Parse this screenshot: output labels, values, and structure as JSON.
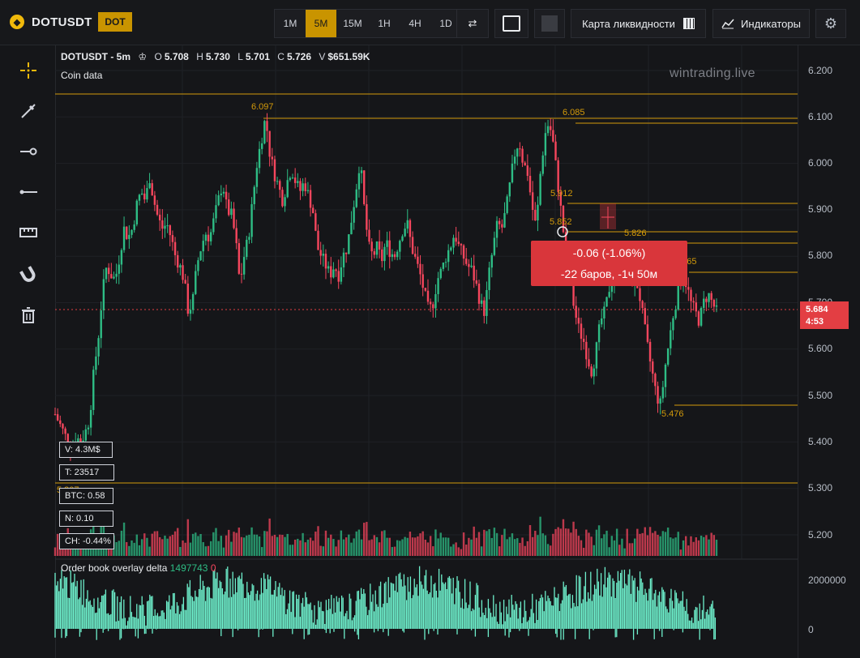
{
  "header": {
    "symbol": "DOTUSDT",
    "badge": "DOT",
    "timeframes": [
      "1M",
      "5M",
      "15M",
      "1H",
      "4H",
      "1D"
    ],
    "active_timeframe": "5M",
    "liquidity_map_label": "Карта ликвидности",
    "indicators_label": "Индикаторы"
  },
  "info": {
    "pair_tf": "DOTUSDT - 5m",
    "o_label": "O",
    "o": "5.708",
    "h_label": "H",
    "h": "5.730",
    "l_label": "L",
    "l": "5.701",
    "c_label": "C",
    "c": "5.726",
    "v_label": "V",
    "v": "$651.59K",
    "coin_data": "Coin data"
  },
  "watermark": "wintrading.live",
  "price_labels": {
    "p6097": "6.097",
    "p6085": "6.085",
    "p5912": "5.912",
    "p5852": "5.852",
    "p5826": "5.826",
    "p5765": "5.765",
    "p5476": "5.476",
    "p5307": "5.307"
  },
  "stats": {
    "v": "V: 4.3M$",
    "t": "T: 23517",
    "btc": "BTC: 0.58",
    "n": "N: 0.10",
    "ch": "CH: -0.44%"
  },
  "measure": {
    "line1": "-0.06 (-1.06%)",
    "line2": "-22 баров, -1ч 50м"
  },
  "price_axis": [
    "6.200",
    "6.100",
    "6.000",
    "5.900",
    "5.800",
    "5.700",
    "5.600",
    "5.500",
    "5.400",
    "5.300",
    "5.200"
  ],
  "current_price": {
    "price": "5.684",
    "countdown": "4:53"
  },
  "orderbook": {
    "title": "Order book overlay delta",
    "value_pos": "1497743",
    "value_neg": "0",
    "axis": [
      "2000000",
      "0"
    ]
  },
  "colors": {
    "up": "#2ebd85",
    "down": "#f6465d",
    "accent": "#c99400",
    "level": "#d39a0a",
    "delta": "#6ef0cc"
  },
  "chart_data": {
    "type": "candlestick",
    "symbol": "DOTUSDT",
    "interval": "5m",
    "ylim": [
      5.15,
      6.25
    ],
    "price_trace": [
      5.46,
      5.44,
      5.42,
      5.4,
      5.39,
      5.41,
      5.4,
      5.42,
      5.45,
      5.55,
      5.62,
      5.72,
      5.78,
      5.76,
      5.75,
      5.8,
      5.86,
      5.84,
      5.86,
      5.91,
      5.94,
      5.92,
      5.97,
      5.92,
      5.88,
      5.86,
      5.87,
      5.84,
      5.8,
      5.78,
      5.75,
      5.68,
      5.7,
      5.78,
      5.82,
      5.85,
      5.84,
      5.88,
      5.92,
      5.96,
      5.9,
      5.89,
      5.84,
      5.74,
      5.8,
      5.84,
      5.92,
      6.0,
      6.05,
      6.1,
      6.02,
      5.98,
      5.95,
      5.92,
      5.96,
      5.99,
      5.96,
      5.94,
      5.96,
      5.93,
      5.9,
      5.82,
      5.8,
      5.78,
      5.76,
      5.78,
      5.76,
      5.8,
      5.82,
      5.88,
      5.94,
      6.01,
      5.9,
      5.82,
      5.8,
      5.82,
      5.79,
      5.83,
      5.81,
      5.8,
      5.83,
      5.86,
      5.87,
      5.82,
      5.79,
      5.76,
      5.72,
      5.68,
      5.7,
      5.75,
      5.77,
      5.8,
      5.82,
      5.85,
      5.82,
      5.8,
      5.78,
      5.77,
      5.74,
      5.7,
      5.68,
      5.76,
      5.82,
      5.87,
      5.86,
      5.9,
      5.96,
      6.02,
      6.05,
      6.0,
      5.98,
      5.91,
      5.86,
      5.98,
      6.06,
      6.09,
      6.04,
      5.96,
      5.88,
      5.8,
      5.74,
      5.68,
      5.64,
      5.62,
      5.58,
      5.55,
      5.6,
      5.66,
      5.68,
      5.73,
      5.76,
      5.78,
      5.8,
      5.77,
      5.74,
      5.76,
      5.72,
      5.66,
      5.6,
      5.55,
      5.5,
      5.48,
      5.56,
      5.62,
      5.68,
      5.72,
      5.76,
      5.74,
      5.7,
      5.68,
      5.66,
      5.7,
      5.72,
      5.7,
      5.68
    ]
  }
}
